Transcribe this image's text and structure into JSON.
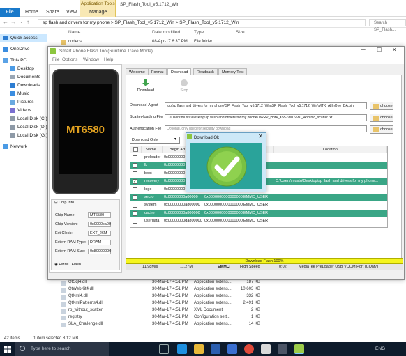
{
  "explorer": {
    "tabs": [
      "File",
      "Home",
      "Share",
      "View",
      "Manage"
    ],
    "contextual_tab": "Application Tools",
    "title": "SP_Flash_Tool_v5.1712_Win",
    "breadcrumb": [
      "sp flash and drivers for my phone",
      "SP_Flash_Tool_v5.1712_Win",
      "SP_Flash_Tool_v5.1712_Win"
    ],
    "search_placeholder": "Search SP_Flash...",
    "columns": [
      "Name",
      "Date modified",
      "Type",
      "Size"
    ],
    "nav_items": [
      "Quick access",
      "OneDrive",
      "This PC",
      "Desktop",
      "Documents",
      "Downloads",
      "Music",
      "Pictures",
      "Videos",
      "Local Disk (C:)",
      "Local Disk (D:)",
      "Local Disk (G:)",
      "Network"
    ],
    "top_files": [
      {
        "name": "codecs",
        "date": "08-Apr-17 6:37 PM",
        "type": "File folder",
        "size": ""
      }
    ],
    "files": [
      {
        "name": "QtSql4.dll",
        "date": "30-Mar-17 4:51 PM",
        "type": "Application extens...",
        "size": "187 KB"
      },
      {
        "name": "QtWebKit4.dll",
        "date": "30-Mar-17 4:51 PM",
        "type": "Application extens...",
        "size": "10,603 KB"
      },
      {
        "name": "QtXml4.dll",
        "date": "30-Mar-17 4:51 PM",
        "type": "Application extens...",
        "size": "332 KB"
      },
      {
        "name": "QtXmlPatterns4.dll",
        "date": "30-Mar-17 4:51 PM",
        "type": "Application extens...",
        "size": "2,491 KB"
      },
      {
        "name": "rb_without_scatter",
        "date": "30-Mar-17 4:51 PM",
        "type": "XML Document",
        "size": "2 KB"
      },
      {
        "name": "registry",
        "date": "30-Mar-17 4:51 PM",
        "type": "Configuration sett...",
        "size": "1 KB"
      },
      {
        "name": "SLA_Challenge.dll",
        "date": "30-Mar-17 4:51 PM",
        "type": "Application extens...",
        "size": "14 KB"
      }
    ],
    "status_items": "42 items",
    "status_selected": "1 item selected  8.12 MB"
  },
  "taskbar": {
    "search_placeholder": "Type here to search",
    "icons": [
      "task-view",
      "edge",
      "explorer",
      "word",
      "store",
      "chrome",
      "photos",
      "settings",
      "flash-tool"
    ],
    "tray": "ENG"
  },
  "flash_tool": {
    "title": "Smart Phone Flash Tool(Runtime Trace Mode)",
    "menu": [
      "File",
      "Options",
      "Window",
      "Help"
    ],
    "tabs": [
      "Welcome",
      "Format",
      "Download",
      "Readback",
      "Memory Test"
    ],
    "active_tab": "Download",
    "toolbar": {
      "download": "Download",
      "stop": "Stop"
    },
    "download_agent_label": "Download-Agent",
    "download_agent_value": "top/sp flash and drivers for my phone\\SP_Flash_Tool_v5.1712_Win\\SP_Flash_Tool_v5.1712_Win\\MTK_AllInOne_DA.bin",
    "scatter_label": "Scatter-loading File",
    "scatter_value": "C:\\Users\\mustu\\Desktop\\sp flash and drivers for my phone\\TWRP_Hot4_X557\\MT6580_Android_scatter.txt",
    "auth_label": "Authentication File",
    "auth_placeholder": "Optional, only used for security download",
    "choose_label": "choose",
    "mode": "Download Only",
    "table_headers": [
      "",
      "Name",
      "Begin Ad",
      "",
      "",
      "Location"
    ],
    "partitions": [
      {
        "name": "preloader",
        "begin": "0x00000000",
        "end": "",
        "region": "T_1",
        "location": "",
        "checked": false,
        "highlight": false
      },
      {
        "name": "lk",
        "begin": "0x00000000",
        "end": "",
        "region": "",
        "location": "",
        "checked": false,
        "highlight": true
      },
      {
        "name": "boot",
        "begin": "0x00000000",
        "end": "",
        "region": "",
        "location": "",
        "checked": false,
        "highlight": false
      },
      {
        "name": "recovery",
        "begin": "0x00000000",
        "end": "",
        "region": "",
        "location": "C:\\Users\\mustu\\Desktop\\sp flash and drivers for my phone...",
        "checked": true,
        "highlight": true
      },
      {
        "name": "logo",
        "begin": "0x00000000",
        "end": "",
        "region": "",
        "location": "",
        "checked": false,
        "highlight": false
      },
      {
        "name": "secro",
        "begin": "0x00000000a00000",
        "end": "0x0000000000000000",
        "region": "EMMC_USER",
        "location": "",
        "checked": false,
        "highlight": true
      },
      {
        "name": "system",
        "begin": "0x00000000a800000",
        "end": "0x0000000000000000",
        "region": "EMMC_USER",
        "location": "",
        "checked": false,
        "highlight": false
      },
      {
        "name": "cache",
        "begin": "0x00000000a800000",
        "end": "0x0000000000000000",
        "region": "EMMC_USER",
        "location": "",
        "checked": false,
        "highlight": true
      },
      {
        "name": "userdata",
        "begin": "0x00000000da800000",
        "end": "0x0000000000000000",
        "region": "EMMC_USER",
        "location": "",
        "checked": false,
        "highlight": false
      }
    ],
    "progress_label": "Download Flash 100%",
    "progress_fraction": 1.0,
    "stats": [
      "11.98M/s",
      "11.27M",
      "EMMC",
      "High Speed",
      "0:02",
      "MediaTek PreLoader USB VCOM Port (COM7)"
    ],
    "chip_model": "MT6580",
    "chip_info_title": "Chip Info",
    "chip_info": [
      {
        "label": "Chip Name:",
        "value": "MT6580"
      },
      {
        "label": "Chip Version:",
        "value": "0x0000ca00"
      },
      {
        "label": "Ext Clock:",
        "value": "EXT_26M"
      },
      {
        "label": "Extern RAM Type:",
        "value": "DRAM"
      },
      {
        "label": "Extern RAM Size:",
        "value": "0x80000000"
      }
    ],
    "emmc_flash": "EMMC Flash",
    "dialog": {
      "title": "Download Ok",
      "close": "✕"
    }
  },
  "colors": {
    "highlight_row": "#3aa686",
    "dialog_body": "#2aa39a",
    "progress": "#f5f51e",
    "check_green": "#7ac143"
  }
}
